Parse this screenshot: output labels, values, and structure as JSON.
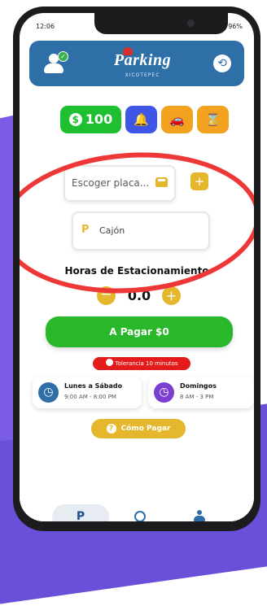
{
  "status_bar": {
    "time": "12:06",
    "battery": "96%"
  },
  "header": {
    "logo_word": "Parking",
    "logo_sub": "XICOTEPEC"
  },
  "top_buttons": {
    "balance": "100"
  },
  "plate": {
    "placeholder": "Escoger placa...",
    "add": "+"
  },
  "slot": {
    "icon": "P",
    "label": "Cajón"
  },
  "hours": {
    "title": "Horas de Estacionamiento",
    "value": "0.0",
    "minus": "−",
    "plus": "+"
  },
  "pay": {
    "label": "A Pagar $0"
  },
  "tolerance": {
    "label": "Tolerancia 10 minutos"
  },
  "schedule": [
    {
      "days": "Lunes a Sábado",
      "hours": "9:00 AM - 8:00 PM",
      "color": "#2f6fa8"
    },
    {
      "days": "Domingos",
      "hours": "8 AM - 3 PM",
      "color": "#7a3fd1"
    }
  ],
  "how_to_pay": {
    "label": "Cómo Pagar"
  },
  "bottom_nav": {
    "parking": "P"
  },
  "colors": {
    "primary": "#2f6fa8",
    "green": "#1fbf32",
    "yellow": "#e4b72d",
    "orange": "#f3a21f",
    "red": "#e31b1b"
  }
}
